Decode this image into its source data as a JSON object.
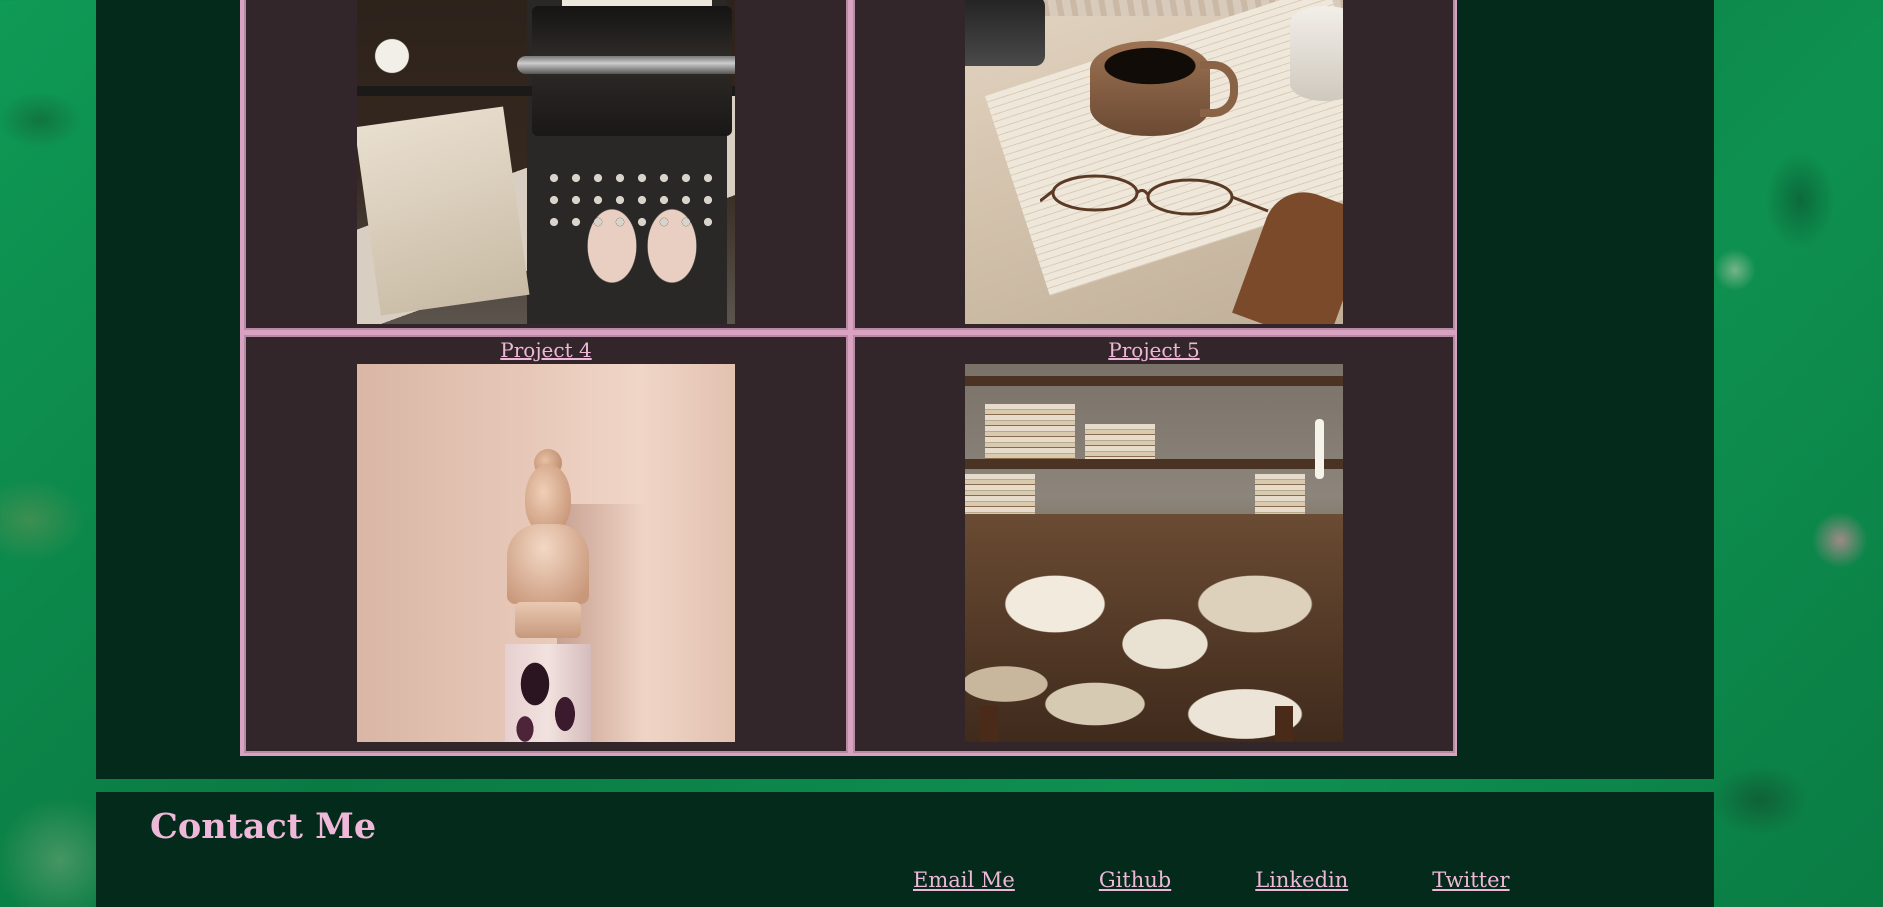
{
  "projects": [
    {
      "label": "",
      "image": "typewriter-photo"
    },
    {
      "label": "",
      "image": "coffee-book-photo"
    },
    {
      "label": "Project 4",
      "image": "statue-photo"
    },
    {
      "label": "Project 5",
      "image": "books-photo"
    }
  ],
  "contact": {
    "title": "Contact Me",
    "links": [
      "Email Me",
      "Github",
      "Linkedin",
      "Twitter"
    ]
  },
  "colors": {
    "panel_bg": "#032a1a",
    "cell_bg": "#32262b",
    "accent_pink": "#f0b8d8",
    "table_border": "#d9a2c0",
    "page_bg": "#0b8a4a"
  }
}
